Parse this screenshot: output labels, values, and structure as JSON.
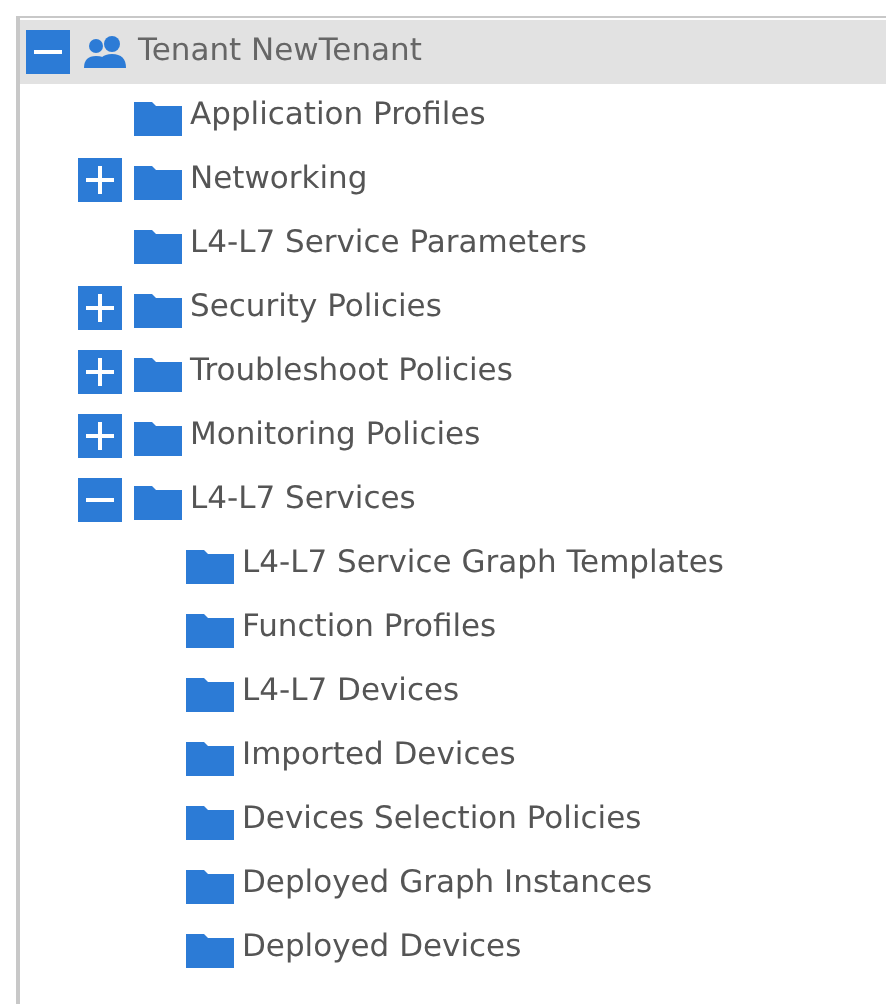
{
  "tree": [
    {
      "label": "Tenant NewTenant",
      "kind": "tenant",
      "selected": true,
      "expanded": true,
      "children": [
        {
          "label": "Application Profiles",
          "kind": "folder",
          "selected": false
        },
        {
          "label": "Networking",
          "kind": "folder",
          "selected": false,
          "expanded": false
        },
        {
          "label": "L4-L7 Service Parameters",
          "kind": "folder",
          "selected": false
        },
        {
          "label": "Security Policies",
          "kind": "folder",
          "selected": false,
          "expanded": false
        },
        {
          "label": "Troubleshoot Policies",
          "kind": "folder",
          "selected": false,
          "expanded": false
        },
        {
          "label": "Monitoring Policies",
          "kind": "folder",
          "selected": false,
          "expanded": false
        },
        {
          "label": "L4-L7 Services",
          "kind": "folder",
          "selected": false,
          "expanded": true,
          "children": [
            {
              "label": "L4-L7 Service Graph Templates",
              "kind": "folder",
              "selected": false
            },
            {
              "label": "Function Profiles",
              "kind": "folder",
              "selected": false
            },
            {
              "label": "L4-L7 Devices",
              "kind": "folder",
              "selected": false
            },
            {
              "label": "Imported Devices",
              "kind": "folder",
              "selected": false
            },
            {
              "label": "Devices Selection Policies",
              "kind": "folder",
              "selected": false
            },
            {
              "label": "Deployed Graph Instances",
              "kind": "folder",
              "selected": false
            },
            {
              "label": "Deployed Devices",
              "kind": "folder",
              "selected": false
            }
          ]
        }
      ]
    }
  ]
}
